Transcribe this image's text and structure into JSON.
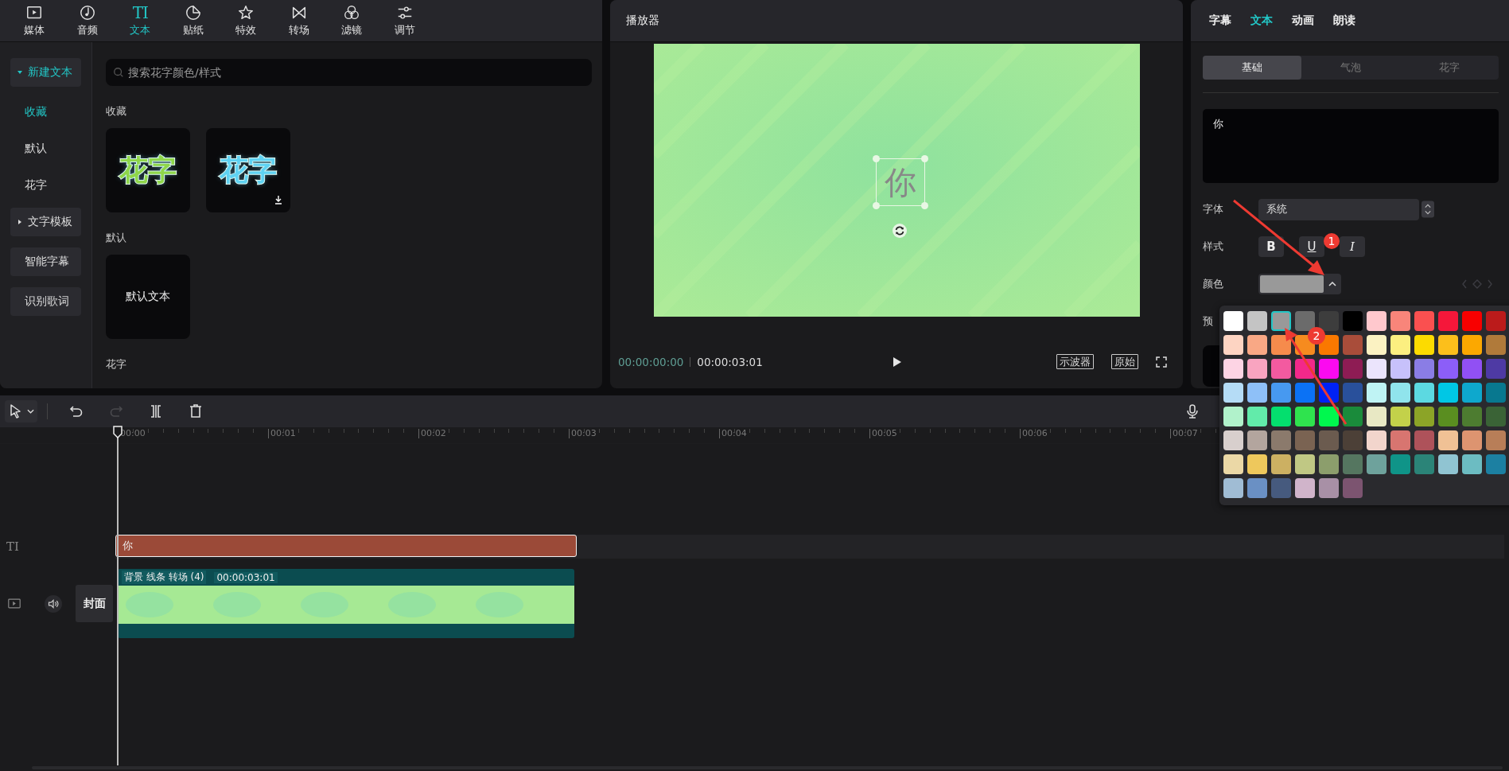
{
  "media_tabs": [
    {
      "label": "媒体",
      "kind": "media",
      "selected": false
    },
    {
      "label": "音频",
      "kind": "audio",
      "selected": false
    },
    {
      "label": "文本",
      "kind": "text",
      "glyph": "TI",
      "selected": true
    },
    {
      "label": "贴纸",
      "kind": "sticker",
      "selected": false
    },
    {
      "label": "特效",
      "kind": "effects",
      "selected": false
    },
    {
      "label": "转场",
      "kind": "transition",
      "selected": false
    },
    {
      "label": "滤镜",
      "kind": "filter",
      "selected": false
    },
    {
      "label": "调节",
      "kind": "adjust",
      "selected": false
    }
  ],
  "sidebar": {
    "items": [
      {
        "label": "新建文本",
        "kind": "group",
        "expanded": true,
        "selected": true
      },
      {
        "label": "收藏",
        "kind": "link",
        "selected": true
      },
      {
        "label": "默认",
        "kind": "link",
        "selected": false
      },
      {
        "label": "花字",
        "kind": "link",
        "selected": false
      },
      {
        "label": "文字模板",
        "kind": "group",
        "expanded": false,
        "selected": false
      },
      {
        "label": "智能字幕",
        "kind": "button",
        "selected": false
      },
      {
        "label": "识别歌词",
        "kind": "button",
        "selected": false
      }
    ]
  },
  "search": {
    "placeholder": "搜索花字颜色/样式"
  },
  "sections": [
    {
      "title": "收藏",
      "cards": [
        {
          "kind": "styled",
          "label": "花字",
          "color": "#8fd64a",
          "download": false
        },
        {
          "kind": "styled",
          "label": "花字",
          "color": "#5fd2f2",
          "download": true
        }
      ]
    },
    {
      "title": "默认",
      "cards": [
        {
          "kind": "plain",
          "label": "默认文本"
        }
      ]
    },
    {
      "title": "花字"
    }
  ],
  "player": {
    "title": "播放器",
    "overlay_text": "你",
    "current_time": "00:00:00:00",
    "duration": "00:00:03:01",
    "buttons": [
      "示波器",
      "原始"
    ]
  },
  "inspector": {
    "tabs": [
      {
        "label": "字幕",
        "selected": false
      },
      {
        "label": "文本",
        "selected": true
      },
      {
        "label": "动画",
        "selected": false
      },
      {
        "label": "朗读",
        "selected": false
      }
    ],
    "subtabs": [
      {
        "label": "基础",
        "selected": true
      },
      {
        "label": "气泡",
        "selected": false
      },
      {
        "label": "花字",
        "selected": false
      }
    ],
    "text_value": "你",
    "font_label": "字体",
    "font_value": "系统",
    "style_label": "样式",
    "style_buttons": [
      {
        "label": "B",
        "kind": "bold"
      },
      {
        "label": "U",
        "kind": "underline"
      },
      {
        "label": "I",
        "kind": "italic"
      }
    ],
    "color_label": "颜色",
    "preset_label": "预"
  },
  "palette": {
    "rows": [
      [
        {
          "color": "#ffffff",
          "selected": false
        },
        {
          "color": "#c4c4c4",
          "selected": false
        },
        {
          "color": "#999999",
          "selected": true
        },
        {
          "color": "#6b6b6b",
          "selected": false
        },
        {
          "color": "#3d3d3d",
          "selected": false
        },
        {
          "color": "#000000",
          "selected": false
        },
        {
          "color": "#ffc8cd",
          "selected": false
        },
        {
          "color": "#f8857a",
          "selected": false
        },
        {
          "color": "#fa5050",
          "selected": false
        },
        {
          "color": "#f5173a",
          "selected": false
        },
        {
          "color": "#f80000",
          "selected": false
        },
        {
          "color": "#bb1b1b",
          "selected": false
        }
      ],
      [
        {
          "color": "#fdd4c2",
          "selected": false
        },
        {
          "color": "#f9a885",
          "selected": false
        },
        {
          "color": "#f68b4c",
          "selected": false
        },
        {
          "color": "#f68b1f",
          "selected": false
        },
        {
          "color": "#fa7800",
          "selected": false
        },
        {
          "color": "#a94d3a",
          "selected": false
        },
        {
          "color": "#fbf2c2",
          "selected": false
        },
        {
          "color": "#fcef80",
          "selected": false
        },
        {
          "color": "#fcdb00",
          "selected": false
        },
        {
          "color": "#fcbf1b",
          "selected": false
        },
        {
          "color": "#fca800",
          "selected": false
        },
        {
          "color": "#b07a3a",
          "selected": false
        }
      ],
      [
        {
          "color": "#fdd4e4",
          "selected": false
        },
        {
          "color": "#f9a4c0",
          "selected": false
        },
        {
          "color": "#f35aa0",
          "selected": false
        },
        {
          "color": "#f3288a",
          "selected": false
        },
        {
          "color": "#fb0af0",
          "selected": false
        },
        {
          "color": "#8e1c54",
          "selected": false
        },
        {
          "color": "#ebe4fc",
          "selected": false
        },
        {
          "color": "#c7c1fb",
          "selected": false
        },
        {
          "color": "#8a7de5",
          "selected": false
        },
        {
          "color": "#8c5ef8",
          "selected": false
        },
        {
          "color": "#9150f4",
          "selected": false
        },
        {
          "color": "#4e3aa4",
          "selected": false
        }
      ],
      [
        {
          "color": "#b5dcf6",
          "selected": false
        },
        {
          "color": "#8ec0f8",
          "selected": false
        },
        {
          "color": "#4799f0",
          "selected": false
        },
        {
          "color": "#0b72f5",
          "selected": false
        },
        {
          "color": "#0022f5",
          "selected": false
        },
        {
          "color": "#29509b",
          "selected": false
        },
        {
          "color": "#bff3f4",
          "selected": false
        },
        {
          "color": "#90e4ec",
          "selected": false
        },
        {
          "color": "#5cd9e1",
          "selected": false
        },
        {
          "color": "#00c7e5",
          "selected": false
        },
        {
          "color": "#0ea8cd",
          "selected": false
        },
        {
          "color": "#08788f",
          "selected": false
        }
      ],
      [
        {
          "color": "#b1f2cb",
          "selected": false
        },
        {
          "color": "#62ebaa",
          "selected": false
        },
        {
          "color": "#04df6e",
          "selected": false
        },
        {
          "color": "#2fe34e",
          "selected": false
        },
        {
          "color": "#00f84e",
          "selected": false
        },
        {
          "color": "#1a8b3b",
          "selected": false
        },
        {
          "color": "#e8e8c4",
          "selected": false
        },
        {
          "color": "#c3d14a",
          "selected": false
        },
        {
          "color": "#8ca427",
          "selected": false
        },
        {
          "color": "#5a8e20",
          "selected": false
        },
        {
          "color": "#4d7c30",
          "selected": false
        },
        {
          "color": "#3a6336",
          "selected": false
        }
      ],
      [
        {
          "color": "#d8cfcd",
          "selected": false
        },
        {
          "color": "#b3a59e",
          "selected": false
        },
        {
          "color": "#8b7a6c",
          "selected": false
        },
        {
          "color": "#7a6352",
          "selected": false
        },
        {
          "color": "#6b5b4f",
          "selected": false
        },
        {
          "color": "#4c4037",
          "selected": false
        },
        {
          "color": "#f2d5cc",
          "selected": false
        },
        {
          "color": "#d87570",
          "selected": false
        },
        {
          "color": "#ae525a",
          "selected": false
        },
        {
          "color": "#f0c195",
          "selected": false
        },
        {
          "color": "#dd9470",
          "selected": false
        },
        {
          "color": "#b87e58",
          "selected": false
        }
      ],
      [
        {
          "color": "#ebd8a6",
          "selected": false
        },
        {
          "color": "#eec85c",
          "selected": false
        },
        {
          "color": "#ccb062",
          "selected": false
        },
        {
          "color": "#c0c884",
          "selected": false
        },
        {
          "color": "#8c9e6c",
          "selected": false
        },
        {
          "color": "#557660",
          "selected": false
        },
        {
          "color": "#6ea29c",
          "selected": false
        },
        {
          "color": "#0f9488",
          "selected": false
        },
        {
          "color": "#2b8478",
          "selected": false
        },
        {
          "color": "#90c4d2",
          "selected": false
        },
        {
          "color": "#6cbcc2",
          "selected": false
        },
        {
          "color": "#1c80a2",
          "selected": false
        }
      ],
      [
        {
          "color": "#a0bcd4",
          "selected": false
        },
        {
          "color": "#6a90c4",
          "selected": false
        },
        {
          "color": "#465a7e",
          "selected": false
        },
        {
          "color": "#d0b4ca",
          "selected": false
        },
        {
          "color": "#a890a6",
          "selected": false
        },
        {
          "color": "#7c5470",
          "selected": false
        }
      ]
    ]
  },
  "toolbar": {
    "tools": [
      {
        "kind": "select",
        "disabled": false
      },
      {
        "kind": "undo",
        "disabled": false
      },
      {
        "kind": "redo",
        "disabled": true
      },
      {
        "kind": "split",
        "disabled": false
      },
      {
        "kind": "delete",
        "disabled": false
      }
    ]
  },
  "timeline": {
    "ruler": [
      "00:00",
      "00:01",
      "00:02",
      "00:03",
      "00:04",
      "00:05",
      "00:06",
      "00:07"
    ],
    "text_track": {
      "icon_text": "TI",
      "clip_label": "你"
    },
    "video_track": {
      "clip_name": "背景 线条 转场 (4)",
      "clip_duration": "00:00:03:01",
      "cover_label": "封面"
    }
  },
  "annotations": [
    {
      "label": "1"
    },
    {
      "label": "2"
    }
  ]
}
